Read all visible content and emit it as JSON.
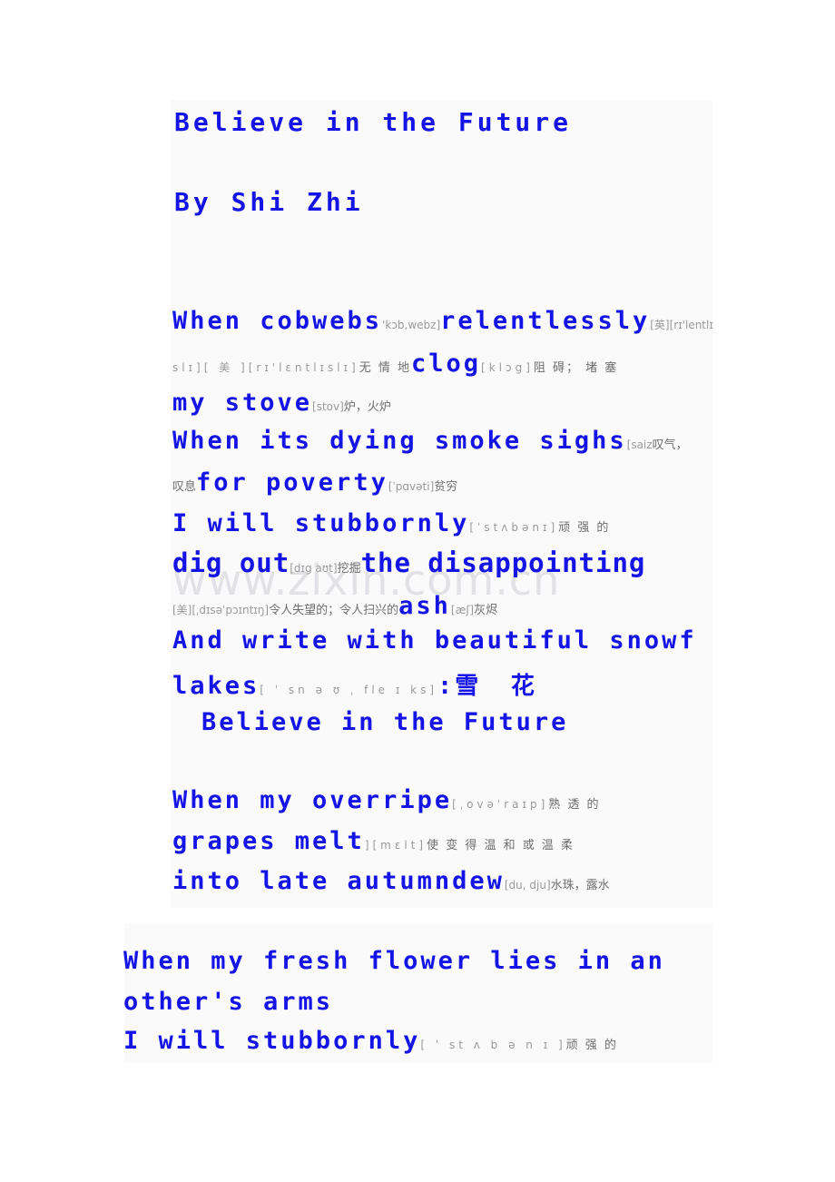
{
  "document": {
    "title": "Believe in the Future",
    "author": "By Shi Zhi",
    "watermark": "www.zixin.com.cn",
    "text_color": "#1414e6",
    "annotation_color": "#9a9a9a",
    "page_background": "#ffffff",
    "panel_background": "#fafafa"
  },
  "lines": {
    "title": "Believe  in  the  Future",
    "author": "By  Shi  Zhi",
    "s1_1_a": "When   cobwebs",
    "s1_1_ph": "'kɔb,webz]",
    "s1_1_b": "relentlessly",
    "s1_1_ph2": "[英][rɪ'lentlɪ",
    "s1_2_ph": "slɪ][ 美 ][rɪ'lɛntlɪslɪ]",
    "s1_2_gl": "无 情 地",
    "s1_2_b": "clog",
    "s1_2_ph2": "[klɔg]",
    "s1_2_gl2": "阻 碍； 堵 塞",
    "s1_3_a": "my  stove",
    "s1_3_ph": "[stov]",
    "s1_3_gl": "炉，火炉",
    "s1_4_a": "When  its  dying  smoke  sighs",
    "s1_4_ph": "[saiz",
    "s1_4_gl": "叹气，",
    "s1_5_gl": "叹息",
    "s1_5_a": "for  poverty",
    "s1_5_ph": "[ˈpɑvəti]",
    "s1_5_gl2": "贫穷",
    "s1_6_a": "I  will  stubbornly",
    "s1_6_ph": "[ˈstʌbənɪ]",
    "s1_6_gl": "顽 强 的",
    "s1_7_a": "dig  out",
    "s1_7_ph": "[dɪg aʊt]",
    "s1_7_gl": "挖掘",
    "s1_7_b": "the  disappointing",
    "s1_8_ph": "[美][ˌdɪsəˈpɔɪntɪŋ]",
    "s1_8_gl": "令人失望的；令人扫兴的",
    "s1_8_b": "ash",
    "s1_8_ph2": "[æʃ]",
    "s1_8_gl2": "灰烬",
    "s1_9_a": "And  write  with  beautiful  snowf",
    "s1_10_a": "lakes",
    "s1_10_ph": "[ ˈ sn ə ʊ ˌ fle ɪ ks]",
    "s1_10_b": ":",
    "s1_10_cn": "雪 花",
    "s1_11_a": "Believe  in  the  Future",
    "s2_1_a": "When  my  overripe",
    "s2_1_ph": "[ˌovəˈraɪp]",
    "s2_1_gl": "熟 透 的",
    "s2_2_a": "grapes  melt",
    "s2_2_ph": "][mɛlt]",
    "s2_2_gl": "使 变 得 温 和 或 温 柔",
    "s2_3_a": "into  late  autumn",
    "s2_3_b": "dew",
    "s2_3_ph": "[du, dju]",
    "s2_3_gl": "水珠，露水",
    "s3_1_a": "When  my  fresh  flower  lies  in  an",
    "s3_2_a": "other's  arms",
    "s3_3_a": "I  will  stubbornly",
    "s3_3_ph": "[ ˈ st ʌ b ə n ɪ ]",
    "s3_3_gl": "顽 强 的"
  }
}
